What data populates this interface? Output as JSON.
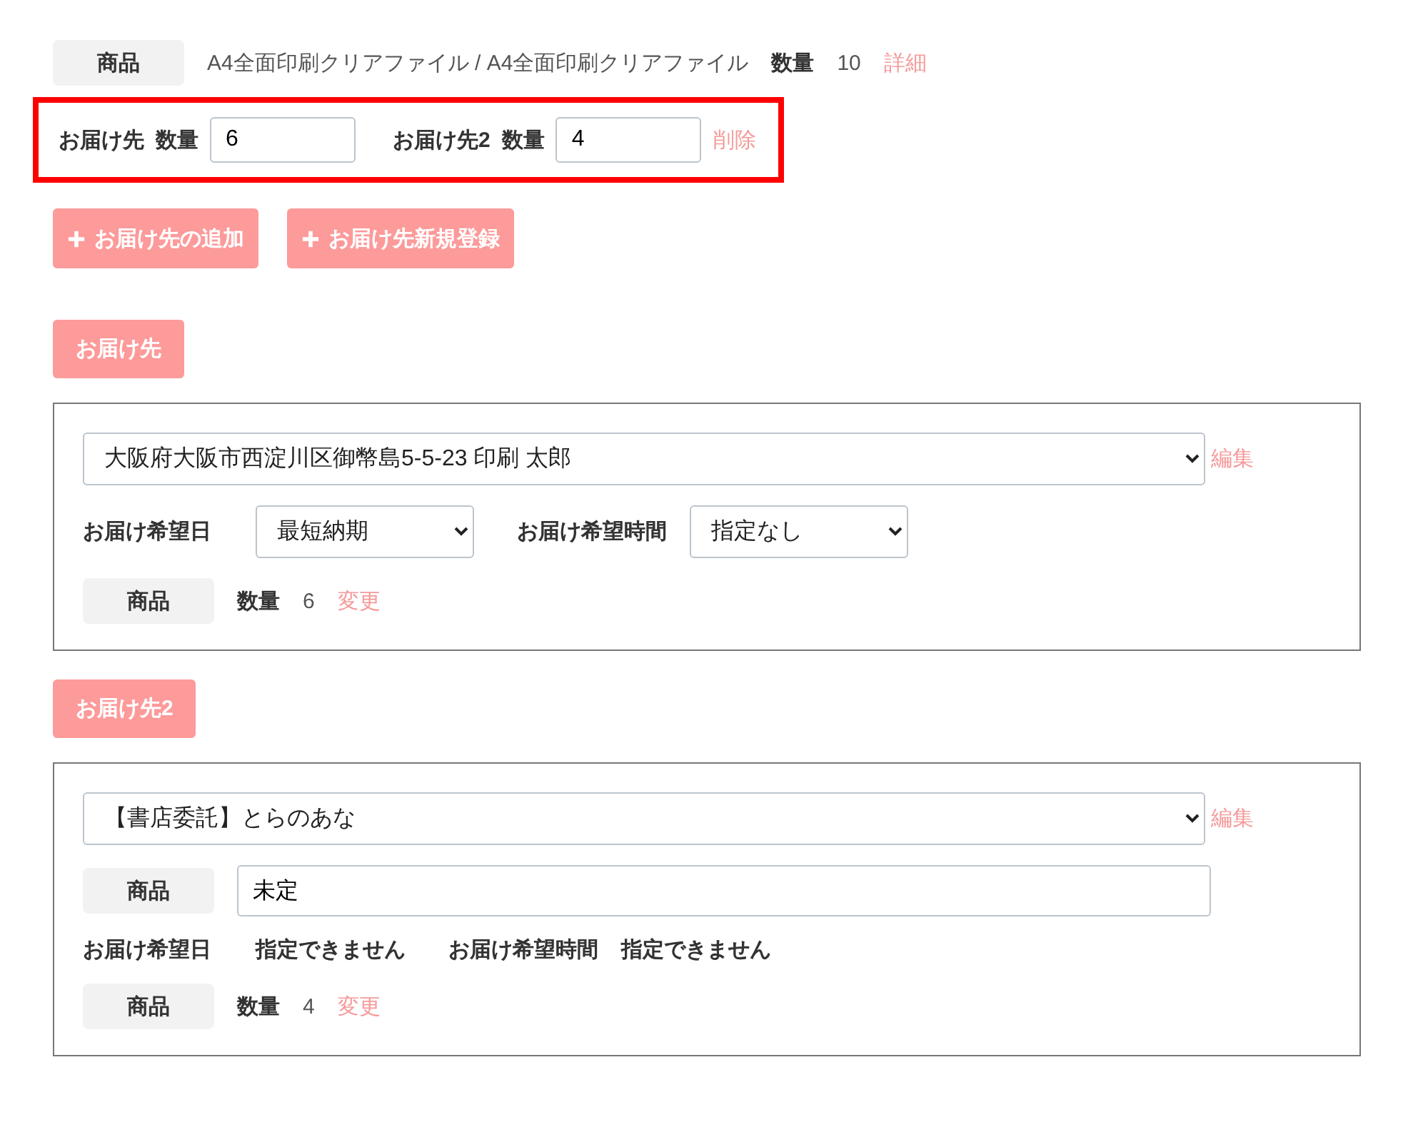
{
  "product_row": {
    "label": "商品",
    "name": "A4全面印刷クリアファイル / A4全面印刷クリアファイル",
    "qty_label": "数量",
    "qty": "10",
    "detail_link": "詳細"
  },
  "allocation": {
    "highlighted": true,
    "entries": [
      {
        "label": "お届け先",
        "qty_label": "数量",
        "value": "6"
      },
      {
        "label": "お届け先2",
        "qty_label": "数量",
        "value": "4",
        "delete_link": "削除"
      }
    ]
  },
  "buttons": [
    "お届け先の追加",
    "お届け先新規登録"
  ],
  "destinations": [
    {
      "kind": "selectable",
      "tag": "お届け先",
      "address": "大阪府大阪市西淀川区御幣島5-5-23 印刷 太郎",
      "edit_link": "編集",
      "date_label": "お届け希望日",
      "date_value": "最短納期",
      "time_label": "お届け希望時間",
      "time_value": "指定なし",
      "product_label": "商品",
      "qty_label": "数量",
      "qty": "6",
      "change_link": "変更"
    },
    {
      "kind": "fixed",
      "tag": "お届け先2",
      "address": "【書店委託】とらのあな",
      "edit_link": "編集",
      "product_field_label": "商品",
      "product_field_value": "未定",
      "date_label": "お届け希望日",
      "date_value": "指定できません",
      "time_label": "お届け希望時間",
      "time_value": "指定できません",
      "product_label": "商品",
      "qty_label": "数量",
      "qty": "4",
      "change_link": "変更"
    }
  ]
}
